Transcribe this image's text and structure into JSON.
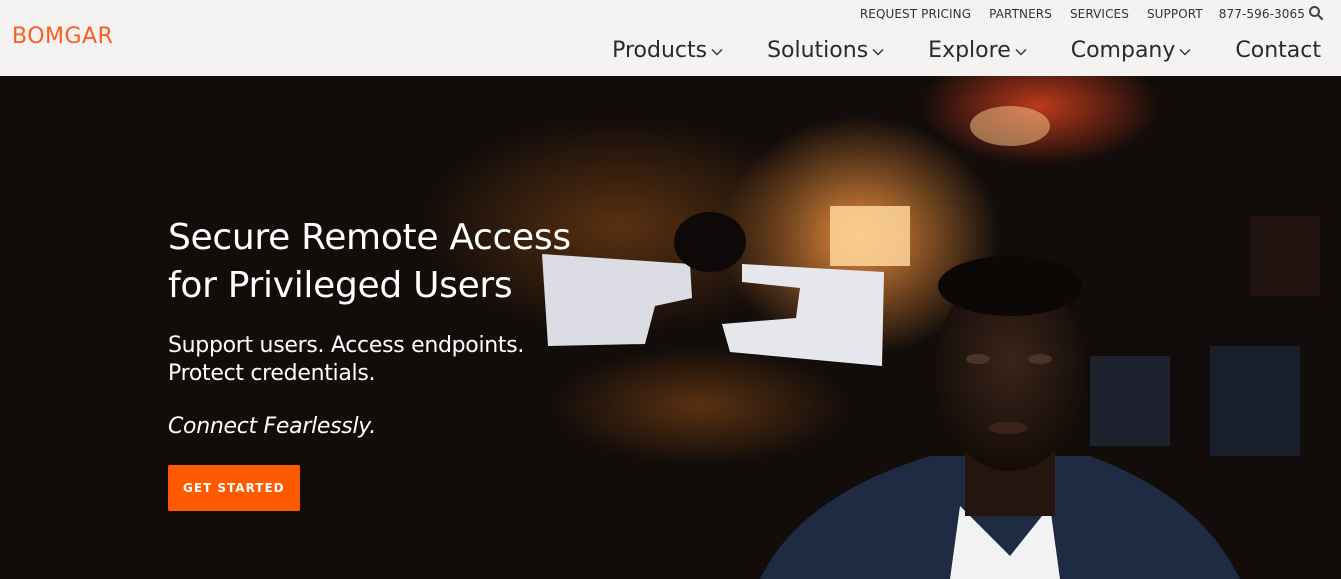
{
  "brand": {
    "logo_text": "BOMGAR",
    "accent": "#ff5a1f"
  },
  "utility_nav": {
    "items": [
      "REQUEST PRICING",
      "PARTNERS",
      "SERVICES",
      "SUPPORT"
    ],
    "phone": "877-596-3065",
    "search_icon": "search-icon"
  },
  "main_nav": {
    "items": [
      {
        "label": "Products",
        "has_dropdown": true
      },
      {
        "label": "Solutions",
        "has_dropdown": true
      },
      {
        "label": "Explore",
        "has_dropdown": true
      },
      {
        "label": "Company",
        "has_dropdown": true
      },
      {
        "label": "Contact",
        "has_dropdown": false
      }
    ]
  },
  "hero": {
    "headline_line1": "Secure Remote Access",
    "headline_line2": "for Privileged Users",
    "sub_line1": "Support users. Access endpoints.",
    "sub_line2": "Protect credentials.",
    "tagline": "Connect Fearlessly.",
    "cta_label": "GET STARTED",
    "cta_color": "#ff5a00"
  }
}
